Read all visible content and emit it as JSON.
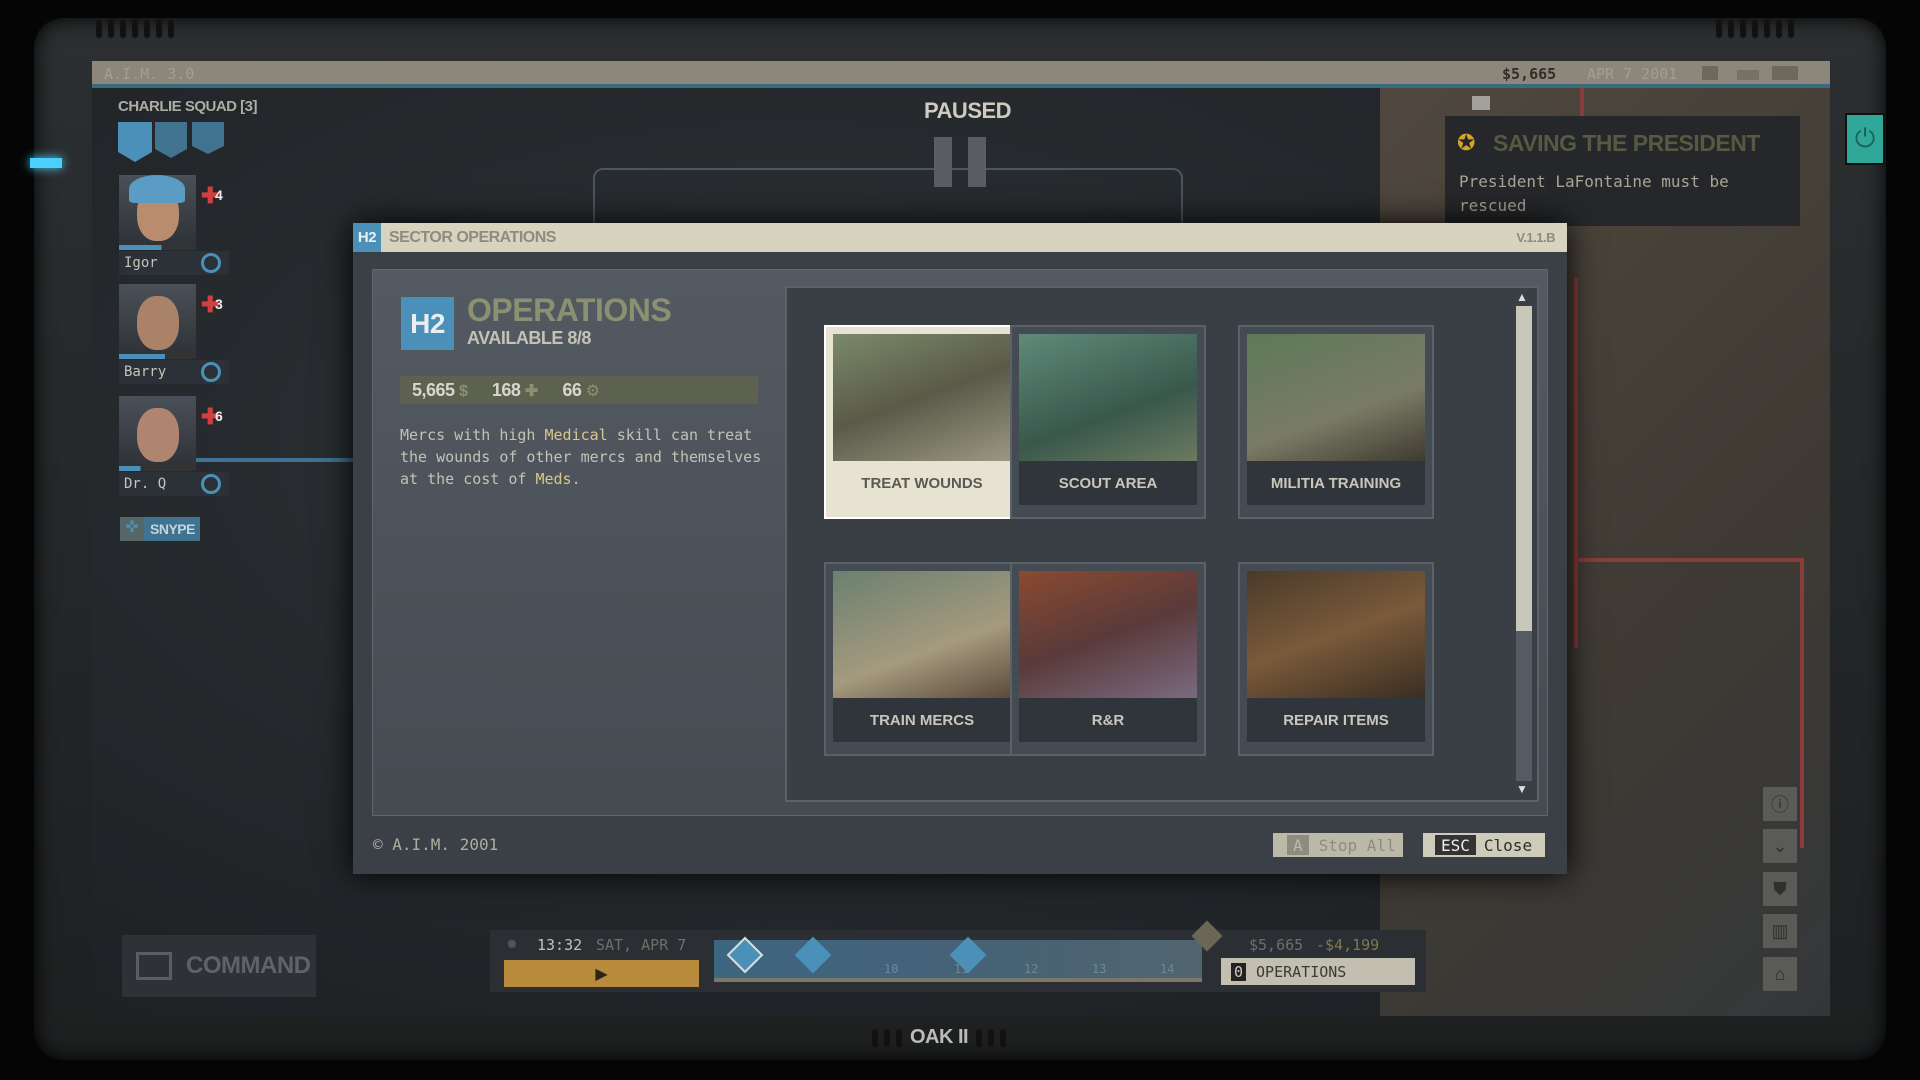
{
  "top_bar": {
    "os_label": "A.I.M. 3.0",
    "money": "$5,665",
    "date": "APR 7 2001"
  },
  "paused": "PAUSED",
  "squad": {
    "title": "CHARLIE SQUAD [3]",
    "mercs": [
      {
        "name": "Igor",
        "wounds": "4"
      },
      {
        "name": "Barry",
        "wounds": "3"
      },
      {
        "name": "Dr. Q",
        "wounds": "6"
      }
    ],
    "extra_merc": "SNYPE"
  },
  "objective": {
    "title": "SAVING THE PRESIDENT",
    "text": "President LaFontaine must be rescued"
  },
  "modal": {
    "sector": "H2",
    "title": "SECTOR OPERATIONS",
    "version": "V.1.1.B",
    "heading": "OPERATIONS",
    "available": "AVAILABLE 8/8",
    "resources": {
      "money": "5,665",
      "meds": "168",
      "parts": "66"
    },
    "description_parts": [
      "Mercs with high ",
      "Medical",
      " skill can treat the wounds of other mercs and themselves at the cost of ",
      "Meds",
      "."
    ],
    "operations": [
      {
        "label": "TREAT WOUNDS",
        "selected": true
      },
      {
        "label": "SCOUT AREA",
        "selected": false
      },
      {
        "label": "MILITIA TRAINING",
        "selected": false
      },
      {
        "label": "TRAIN MERCS",
        "selected": false
      },
      {
        "label": "R&R",
        "selected": false
      },
      {
        "label": "REPAIR ITEMS",
        "selected": false
      }
    ],
    "copyright": "© A.I.M. 2001",
    "stop_all": {
      "key": "A",
      "label": "Stop All"
    },
    "close": {
      "key": "ESC",
      "label": "Close"
    }
  },
  "command": "COMMAND",
  "timeline": {
    "time": "13:32",
    "date": "SAT, APR 7",
    "ticks": [
      "10",
      "11",
      "12",
      "13",
      "14"
    ],
    "funds": "$5,665",
    "expenses": "-$4,199",
    "ops_count": "0",
    "ops_label": "OPERATIONS"
  },
  "device_label": "OAK II",
  "colors": {
    "accent_blue": "#4a90b8",
    "highlight": "#d9c78a",
    "objective": "#d4a52a",
    "power": "#2fa89a"
  }
}
